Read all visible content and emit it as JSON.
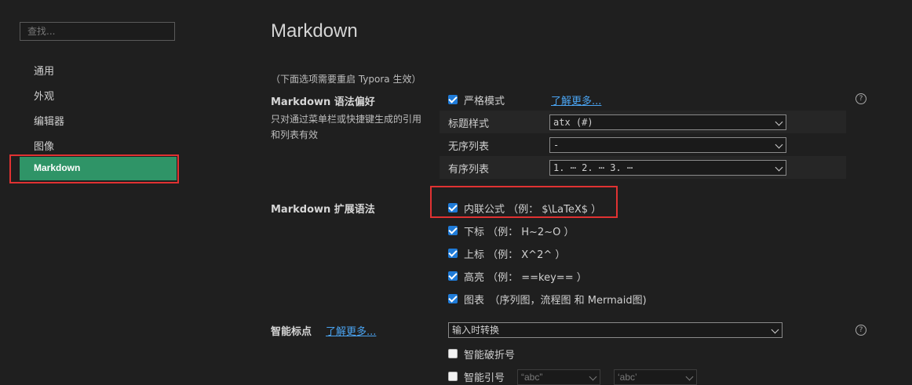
{
  "sidebar": {
    "search_placeholder": "查找...",
    "items": [
      "通用",
      "外观",
      "编辑器",
      "图像",
      "Markdown"
    ]
  },
  "main": {
    "title": "Markdown",
    "restart_note": "（下面选项需要重启 Typora 生效）",
    "syntax": {
      "label": "Markdown 语法偏好",
      "desc": "只对通过菜单栏或快捷键生成的引用和列表有效",
      "strict_mode": "严格模式",
      "learn_more": "了解更多...",
      "heading_style_label": "标题样式",
      "heading_style_value": "atx (#)",
      "ul_label": "无序列表",
      "ul_value": "-",
      "ol_label": "有序列表",
      "ol_value": "1. ⋯ 2. ⋯ 3. ⋯"
    },
    "ext": {
      "label": "Markdown 扩展语法",
      "inline_math": "内联公式 （例： $\\LaTeX$ ）",
      "subscript": "下标 （例： H~2~O ）",
      "superscript": "上标 （例： X^2^ ）",
      "highlight": "高亮 （例： ==key== ）",
      "diagrams": "图表　（序列图，流程图 和 Mermaid图)"
    },
    "smart": {
      "label": "智能标点",
      "learn_more": "了解更多...",
      "mode_value": "输入时转换",
      "dashes": "智能破折号",
      "quotes": "智能引号",
      "double_quote_value": "“abc”",
      "single_quote_value": "‘abc’"
    },
    "help_glyph": "?"
  },
  "colors": {
    "background": "#1f1f1f",
    "active_item": "#2f9467",
    "highlight_box": "#e03232",
    "checkbox": "#1f7bd8",
    "link": "#4aa3f0"
  },
  "checkboxes": {
    "strict_mode": true,
    "inline_math": true,
    "subscript": true,
    "superscript": true,
    "highlight": true,
    "diagrams": true,
    "smart_dashes": false,
    "smart_quotes": false
  }
}
